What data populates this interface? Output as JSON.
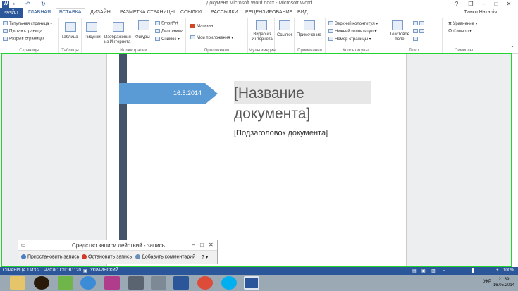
{
  "window": {
    "title": "Документ Microsoft Word.docx - Microsoft Word",
    "logo": "W",
    "controls": [
      "?",
      "❐",
      "–",
      "□",
      "✕"
    ]
  },
  "tabs": {
    "file": "ФАЙЛ",
    "items": [
      "ГЛАВНАЯ",
      "ВСТАВКА",
      "ДИЗАЙН",
      "РАЗМЕТКА СТРАНИЦЫ",
      "ССЫЛКИ",
      "РАССЫЛКИ",
      "РЕЦЕНЗИРОВАНИЕ",
      "ВИД"
    ],
    "active": "ВСТАВКА"
  },
  "user": "Тимко Наталія",
  "ribbon": {
    "pages": {
      "items": [
        "Титульная страница ▾",
        "Пустая страница",
        "Разрыв страницы"
      ],
      "label": "Страницы"
    },
    "tables": {
      "item": "Таблица",
      "label": "Таблицы"
    },
    "illustrations": {
      "items": [
        "Рисунки",
        "Изображения из Интернета",
        "Фигуры"
      ],
      "small": [
        "SmartArt",
        "Диаграмма",
        "Снимок ▾"
      ],
      "label": "Иллюстрации"
    },
    "apps": {
      "items": [
        "Магазин",
        "Мои приложения ▾"
      ],
      "label": "Приложения"
    },
    "media": {
      "item": "Видео из Интернета",
      "label": "Мультимедиа"
    },
    "links": {
      "item": "Ссылки"
    },
    "comments": {
      "item": "Примечание",
      "label": "Примечания"
    },
    "headers": {
      "items": [
        "Верхний колонтитул ▾",
        "Нижний колонтитул ▾",
        "Номер страницы ▾"
      ],
      "label": "Колонтитулы"
    },
    "text": {
      "item": "Текстовое поле",
      "label": "Текст"
    },
    "symbols": {
      "items": [
        "Уравнение ▾",
        "Символ ▾"
      ],
      "label": "Символы"
    }
  },
  "document": {
    "date": "16.5.2014",
    "title": "[Название документа]",
    "subtitle": "[Подзаголовок документа]"
  },
  "psr": {
    "title": "Средство записи действий - запись",
    "pause": "Приостановить запись",
    "stop": "Остановить запись",
    "comment": "Добавить комментарий"
  },
  "status": {
    "page": "СТРАНИЦА 1 ИЗ 2",
    "words": "ЧИСЛО СЛОВ: 120",
    "lang": "УКРАИНСКИЙ",
    "zoom": "100%"
  },
  "taskbar": {
    "lang": "УКР",
    "time": "21:39",
    "date": "16.05.2014"
  },
  "colors": {
    "accent": "#2b579a",
    "sidebar": "#44546a",
    "arrow": "#5b9bd5",
    "highlight": "#22d430"
  }
}
